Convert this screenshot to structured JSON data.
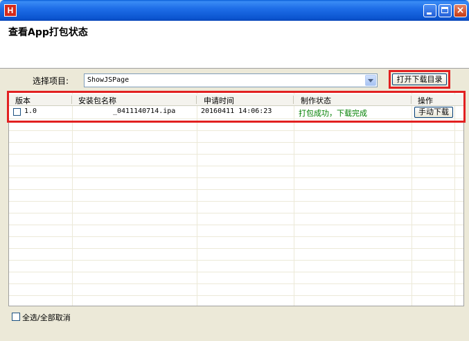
{
  "window": {
    "icon_letter": "H",
    "controls": {
      "minimize": "minimize",
      "maximize": "maximize",
      "close": "×"
    }
  },
  "header": {
    "title": "查看App打包状态"
  },
  "project": {
    "label": "选择项目:",
    "selected": "ShowJSPage",
    "open_dir_button": "打开下载目录"
  },
  "table": {
    "columns": [
      "版本",
      "安装包名称",
      "申请时间",
      "制作状态",
      "操作"
    ],
    "rows": [
      {
        "checked": false,
        "version": "1.0",
        "package_name": "_0411140714.ipa",
        "request_time": "20160411 14:06:23",
        "status": "打包成功，下载完成",
        "action": "手动下载"
      }
    ]
  },
  "footer": {
    "select_all_label": "全选/全部取消"
  },
  "colors": {
    "highlight": "#e22020",
    "status_ok": "#008000",
    "titlebar": "#0b55d0"
  }
}
